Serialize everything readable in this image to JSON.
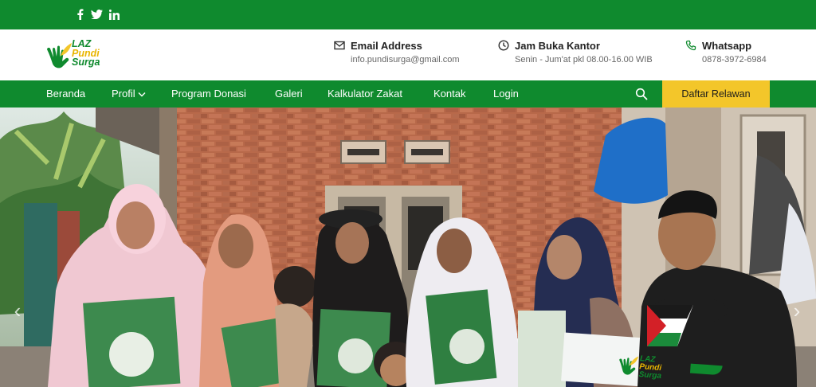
{
  "social": [
    {
      "name": "facebook-icon"
    },
    {
      "name": "twitter-icon"
    },
    {
      "name": "linkedin-icon"
    }
  ],
  "brand": {
    "line1": "LAZ",
    "line2": "Pundi",
    "line3": "Surga",
    "green": "#0f8a2e",
    "yellow": "#f3c62a"
  },
  "contact": {
    "email": {
      "title": "Email Address",
      "value": "info.pundisurga@gmail.com",
      "icon": "envelope-icon"
    },
    "hours": {
      "title": "Jam Buka Kantor",
      "value": "Senin - Jum'at pkl 08.00-16.00 WIB",
      "icon": "clock-icon"
    },
    "whatsapp": {
      "title": "Whatsapp",
      "value": "0878-3972-6984",
      "icon": "phone-icon"
    }
  },
  "nav": {
    "items": [
      {
        "label": "Beranda"
      },
      {
        "label": "Profil"
      },
      {
        "label": "Program Donasi"
      },
      {
        "label": "Galeri"
      },
      {
        "label": "Kalkulator Zakat"
      },
      {
        "label": "Kontak"
      },
      {
        "label": "Login"
      }
    ],
    "cta_label": "Daftar Relawan"
  },
  "hero": {
    "slider_prev": "‹",
    "slider_next": "›",
    "banner": {
      "line1": "LAZ",
      "line2": "Pundi",
      "line3": "Surga"
    }
  }
}
